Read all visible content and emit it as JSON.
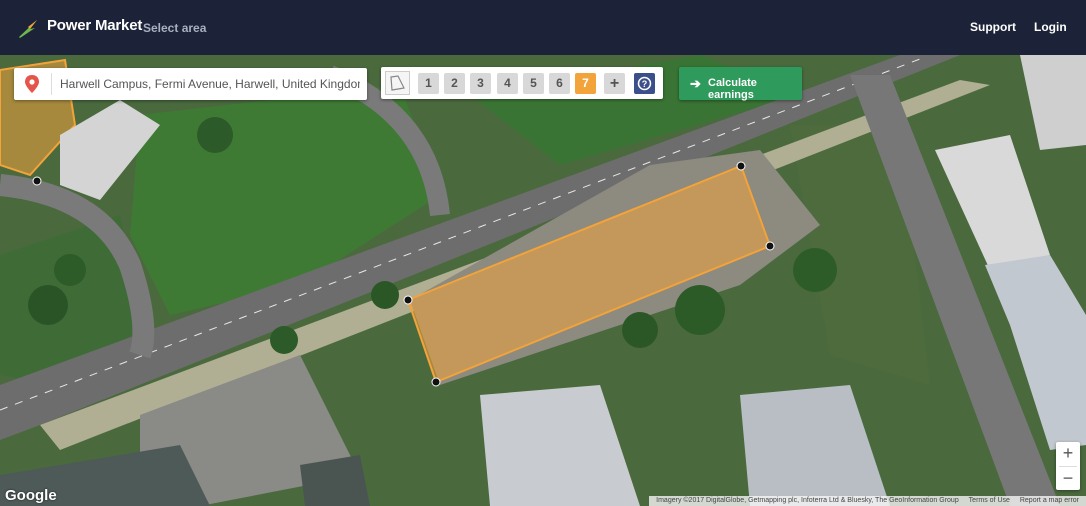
{
  "header": {
    "brand": "Power Market",
    "subtitle": "Select area",
    "nav": {
      "support": "Support",
      "login": "Login"
    }
  },
  "search": {
    "value": "Harwell Campus, Fermi Avenue, Harwell, United Kingdom"
  },
  "toolbar": {
    "area_buttons": [
      "1",
      "2",
      "3",
      "4",
      "5",
      "6",
      "7"
    ],
    "active_area": "7",
    "add_label": "+",
    "help_label": "?",
    "calculate_label": "Calculate earnings"
  },
  "map": {
    "zoom_in": "+",
    "zoom_out": "−",
    "google_logo": "Google",
    "attribution": "Imagery ©2017 DigitalGlobe, Getmapping plc, Infoterra Ltd & Bluesky, The GeoInformation Group",
    "terms": "Terms of Use",
    "report": "Report a map error"
  },
  "colors": {
    "header_bg": "#1c2237",
    "selection": "#f2a33a",
    "calculate_bg": "#2e9a5b",
    "help_bg": "#3b4f8a"
  }
}
